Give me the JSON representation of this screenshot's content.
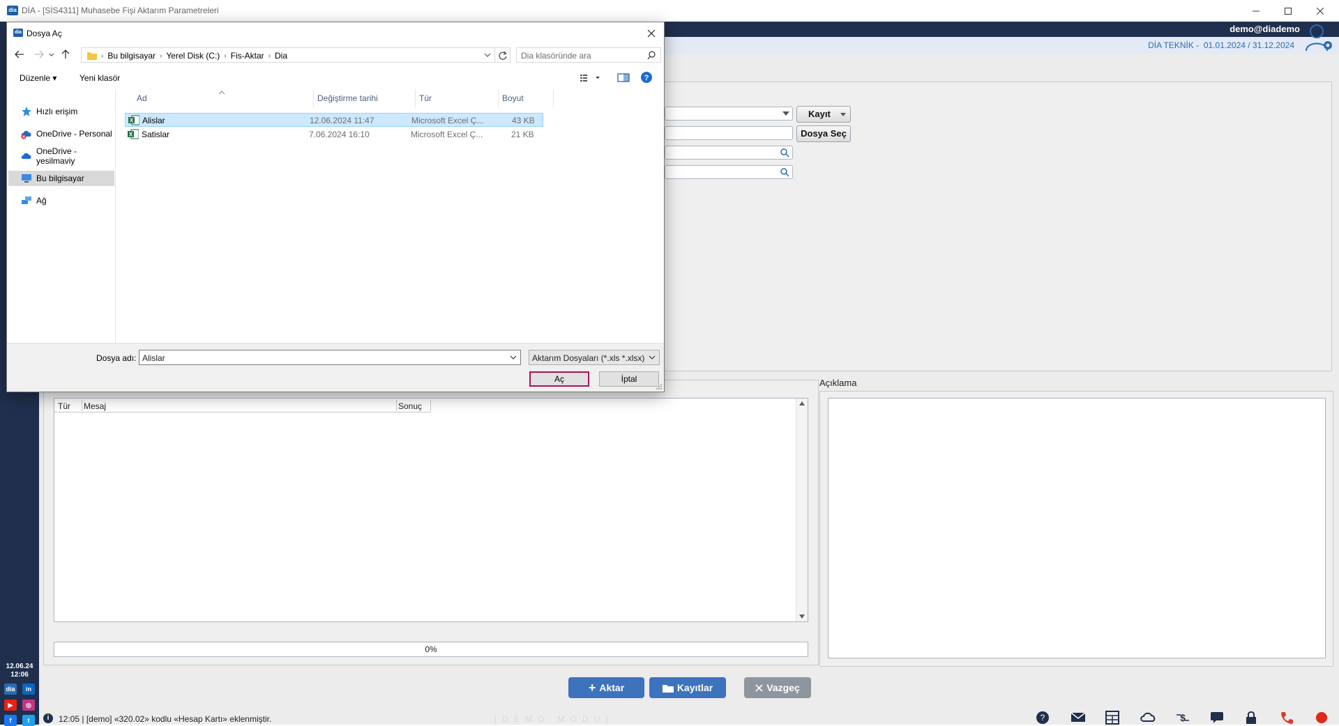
{
  "window": {
    "logo_text": "dia",
    "title": "DİA - [SİS4311] Muhasebe Fişi Aktarım Parametreleri"
  },
  "header": {
    "user": "demo@diademo",
    "company": "DİA TEKNİK -",
    "period": "01.01.2024 / 31.12.2024"
  },
  "sidebar": {
    "date": "12.06.24",
    "time": "12:06",
    "social": [
      "dia",
      "in",
      "▶",
      "◎",
      "f",
      "t"
    ]
  },
  "params": {
    "record_label": "Kayıt",
    "select_file_label": "Dosya Seç"
  },
  "messages": {
    "columns": [
      "Tür",
      "Mesaj",
      "Sonuç"
    ],
    "progress": "0%"
  },
  "description": {
    "label": "Açıklama"
  },
  "actions": {
    "transfer": "Aktar",
    "records": "Kayıtlar",
    "cancel": "Vazgeç"
  },
  "status": {
    "message": "12:05 | [demo] «320.02» kodlu «Hesap Kartı» eklenmiştir.",
    "demo_mode": "[DEMO MODU]"
  },
  "dialog": {
    "icon_text": "dia",
    "title": "Dosya Aç",
    "breadcrumb": [
      "Bu bilgisayar",
      "Yerel Disk (C:)",
      "Fis-Aktar",
      "Dia"
    ],
    "search_placeholder": "Dia klasöründe ara",
    "organize": "Düzenle",
    "new_folder": "Yeni klasör",
    "nav": [
      "Hızlı erişim",
      "OneDrive - Personal",
      "OneDrive - yesilmaviy",
      "Bu bilgisayar",
      "Ağ"
    ],
    "columns": [
      "Ad",
      "Değiştirme tarihi",
      "Tür",
      "Boyut"
    ],
    "files": [
      {
        "name": "Alislar",
        "date": "12.06.2024 11:47",
        "type": "Microsoft Excel Ç...",
        "size": "43 KB"
      },
      {
        "name": "Satislar",
        "date": "7.06.2024 16:10",
        "type": "Microsoft Excel Ç...",
        "size": "21 KB"
      }
    ],
    "filename_label": "Dosya adı:",
    "filename_value": "Alislar",
    "filetype": "Aktarım Dosyaları (*.xls *.xlsx)",
    "open_label": "Aç",
    "cancel_label": "İptal"
  },
  "colors": {
    "header_navy": "#1f2f4d",
    "accent_blue": "#3d72bd",
    "selection_blue": "#cce8ff",
    "open_button_border": "#b0105a"
  }
}
